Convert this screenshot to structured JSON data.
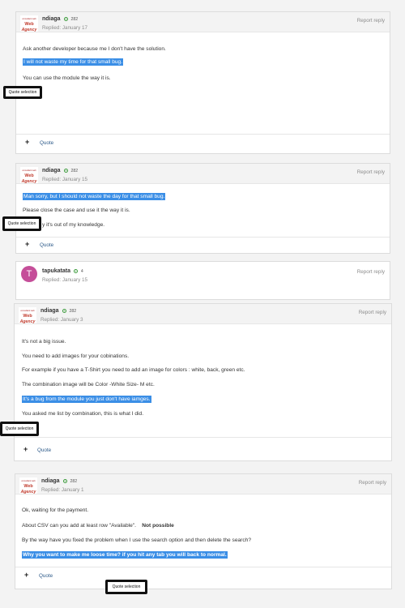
{
  "posts": [
    {
      "author": "ndiaga",
      "rep": "282",
      "date": "Replied: January 17",
      "report": "Report reply",
      "lines": [
        "Ask  another  developer  because  me  I don't have the  solution.",
        "I will not  waste my time  for that small bug.",
        "You can use the module the way  it is."
      ],
      "quote": "Quote",
      "quote_selection": "Quote selection"
    },
    {
      "author": "ndiaga",
      "rep": "282",
      "date": "Replied: January 15",
      "report": "Report reply",
      "lines": [
        "Man  sorry,  but  I should not  waste  the day  for that small bug.",
        "Please  close the case  and use it the way it is.",
        "y  it's  out of my knowledge."
      ],
      "quote": "Quote",
      "quote_selection": "Quote selection"
    },
    {
      "author": "tapukatata",
      "rep": "4",
      "date": "Replied: January 15",
      "report": "Report reply",
      "avatar_letter": "T"
    },
    {
      "author": "ndiaga",
      "rep": "282",
      "date": "Replied: January 3",
      "report": "Report reply",
      "lines": [
        "It's not  a big  issue.",
        "You need to add images for your cobinations.",
        "For  example if you  have  a T-Shirt    you need to add an image for  colors  :  white,  back, green   etc.",
        "The combination image will be   Color -White   Size- M      etc.",
        "It's  a bug from the module you just don't have iamges.",
        "You asked me list by   combination, this is what I did."
      ],
      "quote": "Quote",
      "quote_selection": "Quote selection"
    },
    {
      "author": "ndiaga",
      "rep": "282",
      "date": "Replied: January 1",
      "report": "Report reply",
      "lines": [
        "Ok,  waiting  for  the payment.",
        "About CSV can you add at least row \"Available\".",
        "Not  possible",
        "By the way have you fixed the problem when I use the search option and then delete the search?",
        "Why  you want to make  me loose time?  if you  hit any tab  you will back to normal."
      ],
      "quote": "Quote",
      "quote_selection": "Quote selection"
    }
  ],
  "logo": {
    "tiny": "consultant web",
    "line1": "Web",
    "line2": "Agency"
  },
  "colors": {
    "highlight": "#3a8ee6",
    "avatar": "#c54e99",
    "rep_dot": "#3b9b3b"
  }
}
